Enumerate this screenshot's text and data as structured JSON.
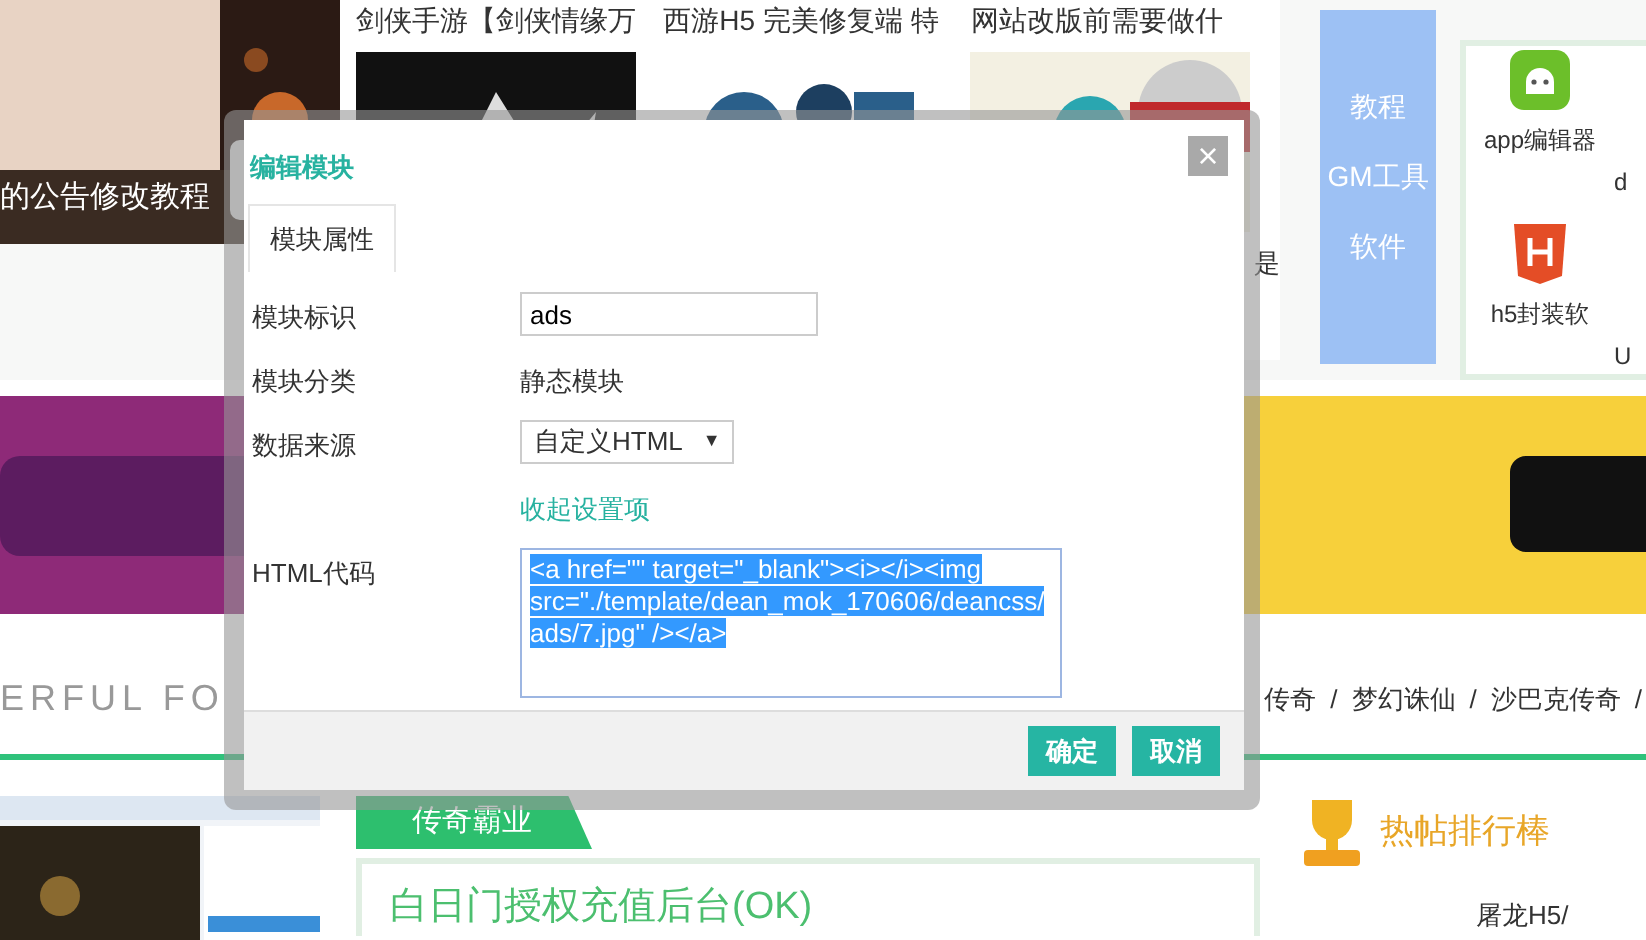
{
  "background": {
    "notice_caption": "的公告修改教程",
    "articles": [
      {
        "title": "剑侠手游【剑侠情缘万"
      },
      {
        "title": "西游H5 完美修复端 特"
      },
      {
        "title": "网站改版前需要做什"
      }
    ],
    "article_fragment": "是",
    "side_tabs": [
      "教程",
      "GM工具",
      "软件"
    ],
    "apps": [
      {
        "label": "app编辑器",
        "kind": "android"
      },
      {
        "label": "d",
        "kind": "none"
      },
      {
        "label": "h5封装软",
        "kind": "html5"
      },
      {
        "label": "U",
        "kind": "none"
      }
    ],
    "section_heading": "ERFUL FO",
    "breadcrumbs": [
      "传奇",
      "梦幻诛仙",
      "沙巴克传奇"
    ],
    "breadcrumb_separator": "/",
    "ribbon": "传奇霸业",
    "headline": "白日门授权充值后台(OK)",
    "hot_title": "热帖排行棒",
    "hot_item": "屠龙H5/"
  },
  "dialog": {
    "title": "编辑模块",
    "close": "×",
    "tabs": [
      {
        "label": "模块属性",
        "selected": true
      }
    ],
    "fields": [
      {
        "label": "模块标识",
        "kind": "input",
        "value": "ads"
      },
      {
        "label": "模块分类",
        "kind": "text",
        "value": "静态模块"
      },
      {
        "label": "数据来源",
        "kind": "select",
        "value": "自定义HTML",
        "caret": "▼"
      },
      {
        "kind": "link",
        "value": "收起设置项"
      },
      {
        "label": "HTML代码",
        "kind": "code",
        "value": "<a href=\"\" target=\"_blank\"><i></i><img src=\"./template/dean_mok_170606/deancss/ads/7.jpg\" /></a>",
        "selected": true
      }
    ],
    "buttons": [
      "确定",
      "取消"
    ]
  }
}
